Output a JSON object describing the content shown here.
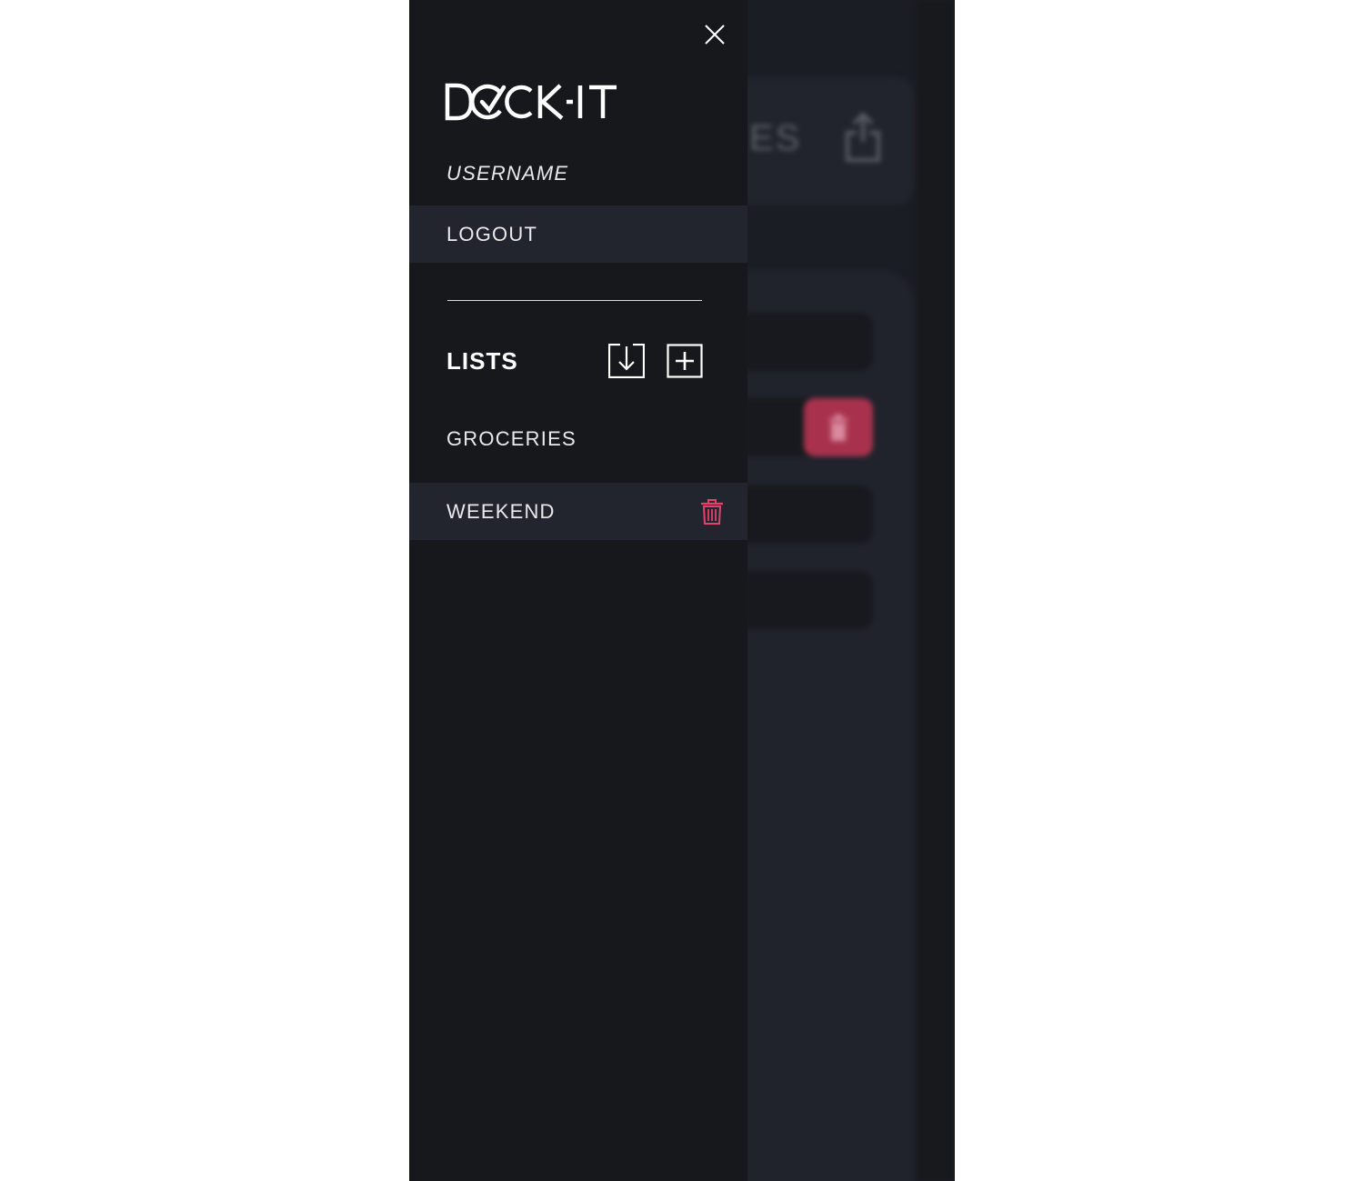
{
  "background_app": {
    "header_title_fragment": "ES",
    "share_icon": "share-icon",
    "delete_icon": "trash-icon",
    "delete_color": "#a8324d"
  },
  "drawer": {
    "close_icon": "close-icon",
    "logo_text": "DOCK-IT",
    "username": "USERNAME",
    "logout_label": "LOGOUT",
    "lists_title": "LISTS",
    "import_icon": "import-download-icon",
    "add_icon": "add-plus-icon",
    "lists": [
      {
        "name": "GROCERIES",
        "active": false
      },
      {
        "name": "WEEKEND",
        "active": true,
        "delete_icon": "trash-icon"
      }
    ],
    "colors": {
      "drawer_bg": "#16181c",
      "active_row_bg": "#22252e",
      "accent_red": "#e0446a",
      "text": "#ffffff"
    }
  }
}
